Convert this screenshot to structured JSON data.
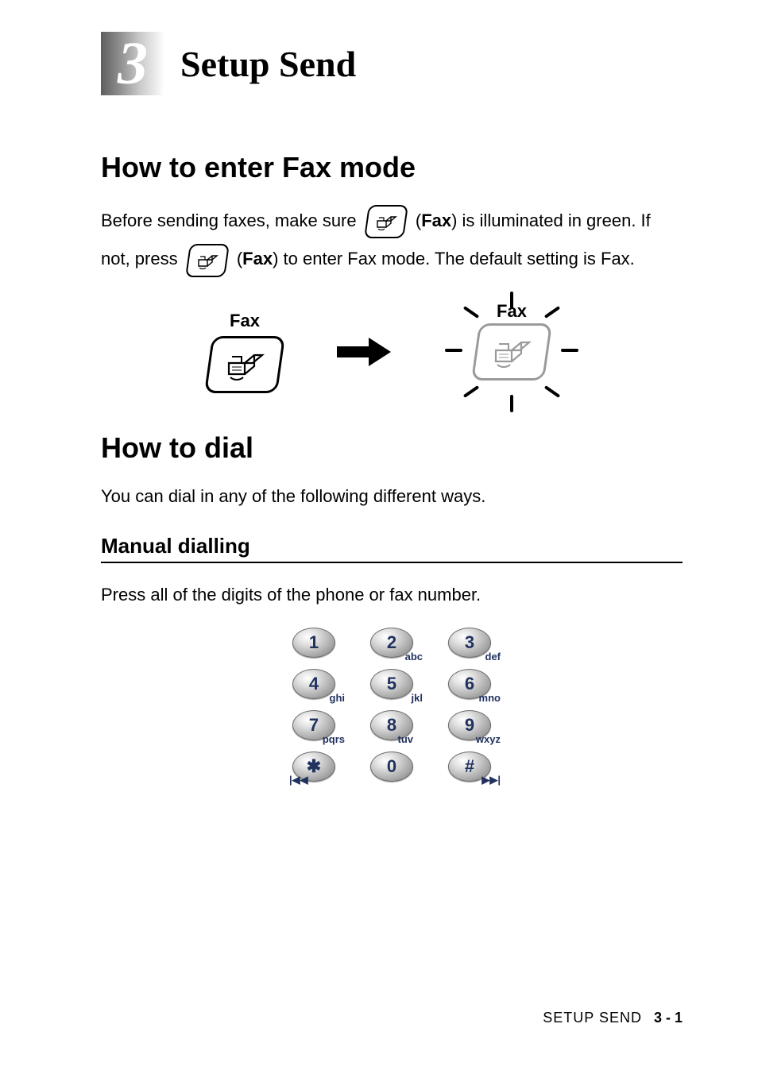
{
  "chapter": {
    "number": "3",
    "title": "Setup Send"
  },
  "section1": {
    "heading": "How to enter Fax mode",
    "para_part1": "Before sending faxes, make sure ",
    "para_part2": " (",
    "para_bold1": "Fax",
    "para_part3": ") is illuminated in green. If not, press ",
    "para_part4": " (",
    "para_bold2": "Fax",
    "para_part5": ") to enter Fax mode. The default setting is Fax."
  },
  "diagram": {
    "label_left": "Fax",
    "label_right": "Fax"
  },
  "section2": {
    "heading": "How to dial",
    "intro": "You can dial in any of the following different ways.",
    "sub_heading": "Manual dialling",
    "sub_text": "Press all of the digits of the phone or fax number."
  },
  "keypad": {
    "rows": [
      [
        {
          "d": "1",
          "s": ""
        },
        {
          "d": "2",
          "s": "abc"
        },
        {
          "d": "3",
          "s": "def"
        }
      ],
      [
        {
          "d": "4",
          "s": "ghi"
        },
        {
          "d": "5",
          "s": "jkl"
        },
        {
          "d": "6",
          "s": "mno"
        }
      ],
      [
        {
          "d": "7",
          "s": "pqrs"
        },
        {
          "d": "8",
          "s": "tuv"
        },
        {
          "d": "9",
          "s": "wxyz"
        }
      ],
      [
        {
          "d": "✱",
          "s": "|◀◀"
        },
        {
          "d": "0",
          "s": ""
        },
        {
          "d": "#",
          "s": "▶▶|"
        }
      ]
    ]
  },
  "footer": {
    "section": "SETUP SEND",
    "page": "3 - 1"
  }
}
